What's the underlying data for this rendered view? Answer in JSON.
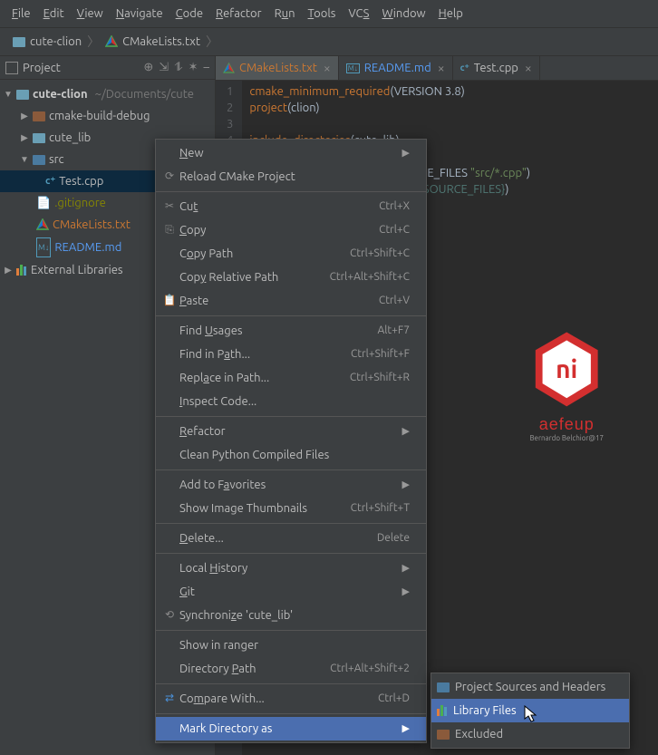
{
  "menu": [
    "File",
    "Edit",
    "View",
    "Navigate",
    "Code",
    "Refactor",
    "Run",
    "Tools",
    "VCS",
    "Window",
    "Help"
  ],
  "breadcrumb": {
    "root": "cute-clion",
    "file": "CMakeLists.txt"
  },
  "sidebar": {
    "title": "Project",
    "root": "cute-clion",
    "root_path": "~/Documents/cute",
    "items": {
      "build": "cmake-build-debug",
      "lib": "cute_lib",
      "src": "src",
      "test": "Test.cpp",
      "gitignore": ".gitignore",
      "cmake": "CMakeLists.txt",
      "readme": "README.md",
      "external": "External Libraries"
    }
  },
  "tabs": {
    "t0": "CMakeLists.txt",
    "t1": "README.md",
    "t2": "Test.cpp"
  },
  "code": {
    "l1a": "cmake_minimum_required",
    "l1b": "(",
    "l1c": "VERSION 3.8",
    "l1d": ")",
    "l2a": "project",
    "l2b": "(clion)",
    "l4a": "include_directories",
    "l4b": "(cute_lib)",
    "l6b": "RCE_FILES ",
    "l6c": "\"src/*.cpp\"",
    "l6d": ")",
    "l7a": "${SOURCE_FILES}",
    "l7b": ")"
  },
  "logo": {
    "text": "ni",
    "brand": "aefeup",
    "sub": "Bernardo Belchior@17"
  },
  "context": {
    "new": "New",
    "reload": "Reload CMake Project",
    "cut": "Cut",
    "copy": "Copy",
    "copypath": "Copy Path",
    "copyrel": "Copy Relative Path",
    "paste": "Paste",
    "find": "Find Usages",
    "findpath": "Find in Path...",
    "replace": "Replace in Path...",
    "inspect": "Inspect Code...",
    "refactor": "Refactor",
    "clean": "Clean Python Compiled Files",
    "favorites": "Add to Favorites",
    "thumbs": "Show Image Thumbnails",
    "delete": "Delete...",
    "history": "Local History",
    "git": "Git",
    "sync": "Synchronize 'cute_lib'",
    "ranger": "Show in ranger",
    "dirpath": "Directory Path",
    "compare": "Compare With...",
    "mark": "Mark Directory as",
    "sc": {
      "cut": "Ctrl+X",
      "copy": "Ctrl+C",
      "copypath": "Ctrl+Shift+C",
      "copyrel": "Ctrl+Alt+Shift+C",
      "paste": "Ctrl+V",
      "find": "Alt+F7",
      "findpath": "Ctrl+Shift+F",
      "replace": "Ctrl+Shift+R",
      "thumbs": "Ctrl+Shift+T",
      "delete": "Delete",
      "dirpath": "Ctrl+Alt+Shift+2",
      "compare": "Ctrl+D"
    }
  },
  "submenu": {
    "src": "Project Sources and Headers",
    "lib": "Library Files",
    "excl": "Excluded"
  }
}
